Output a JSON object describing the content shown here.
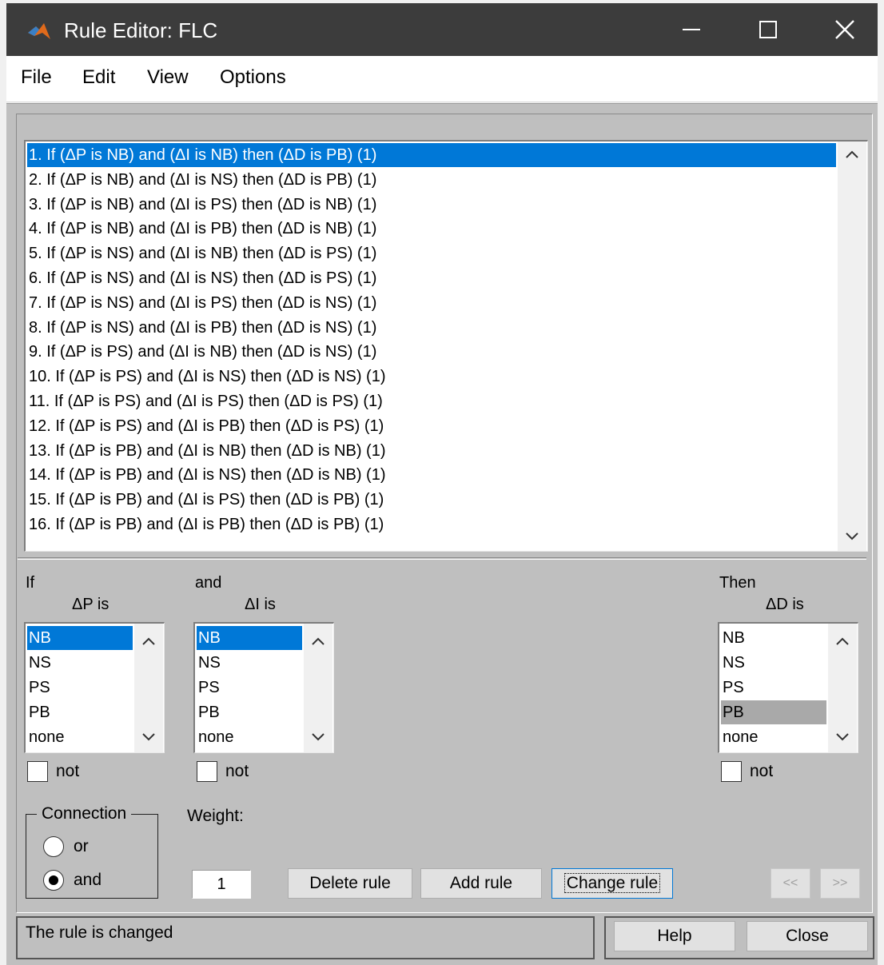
{
  "window": {
    "title": "Rule Editor: FLC"
  },
  "menu": [
    "File",
    "Edit",
    "View",
    "Options"
  ],
  "rules": [
    "1. If (ΔP is NB) and (ΔI is NB) then (ΔD is PB) (1)",
    "2. If (ΔP is NB) and (ΔI is NS) then (ΔD is PB) (1)",
    "3. If (ΔP is NB) and (ΔI is PS) then (ΔD is NB) (1)",
    "4. If (ΔP is NB) and (ΔI is PB) then (ΔD is NB) (1)",
    "5. If (ΔP is NS) and (ΔI is NB) then (ΔD is PS) (1)",
    "6. If (ΔP is NS) and (ΔI is NS) then (ΔD is PS) (1)",
    "7. If (ΔP is NS) and (ΔI is PS) then (ΔD is NS) (1)",
    "8. If (ΔP is NS) and (ΔI is PB) then (ΔD is NS) (1)",
    "9. If (ΔP is PS) and (ΔI is NB) then (ΔD is NS) (1)",
    "10. If (ΔP is PS) and (ΔI is NS) then (ΔD is NS) (1)",
    "11. If (ΔP is PS) and (ΔI is PS) then (ΔD is PS) (1)",
    "12. If (ΔP is PS) and (ΔI is PB) then (ΔD is PS) (1)",
    "13. If (ΔP is PB) and (ΔI is NB) then (ΔD is NB) (1)",
    "14. If (ΔP is PB) and (ΔI is NS) then (ΔD is NB) (1)",
    "15. If (ΔP is PB) and (ΔI is PS) then (ΔD is PB) (1)",
    "16. If (ΔP is PB) and (ΔI is PB) then (ΔD is PB) (1)"
  ],
  "selected_rule": 0,
  "if_label": "If",
  "and_label": "and",
  "then_label": "Then",
  "inputs": [
    {
      "heading": "ΔP is",
      "options": [
        "NB",
        "NS",
        "PS",
        "PB",
        "none"
      ],
      "selected": 0,
      "not_label": "not"
    },
    {
      "heading": "ΔI is",
      "options": [
        "NB",
        "NS",
        "PS",
        "PB",
        "none"
      ],
      "selected": 0,
      "not_label": "not"
    }
  ],
  "output": {
    "heading": "ΔD is",
    "options": [
      "NB",
      "NS",
      "PS",
      "PB",
      "none"
    ],
    "selected": 3,
    "not_label": "not"
  },
  "connection": {
    "title": "Connection",
    "options": [
      "or",
      "and"
    ],
    "selected": "and"
  },
  "weight": {
    "label": "Weight:",
    "value": "1"
  },
  "buttons": {
    "delete": "Delete rule",
    "add": "Add rule",
    "change": "Change rule",
    "prev": "<<",
    "next": ">>",
    "help": "Help",
    "close": "Close"
  },
  "status": "The rule is changed",
  "colors": {
    "titlebar": "#3c3c3c",
    "selection": "#0078d7",
    "background": "#bfbfbf"
  }
}
